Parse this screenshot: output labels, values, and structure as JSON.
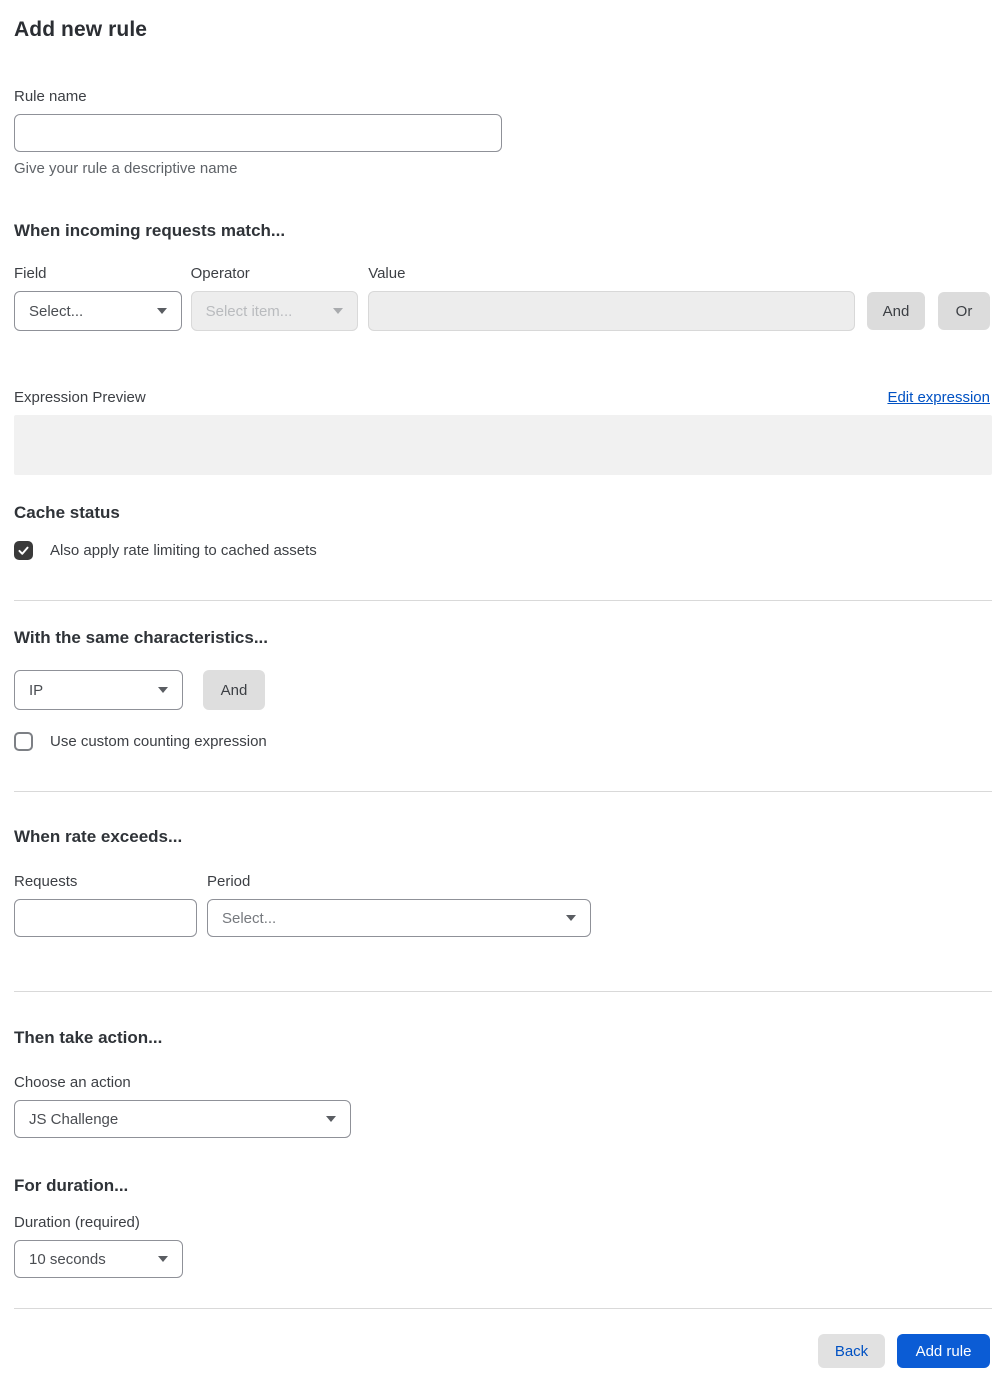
{
  "page": {
    "title": "Add new rule"
  },
  "rule_name": {
    "label": "Rule name",
    "value": "",
    "helper": "Give your rule a descriptive name"
  },
  "match": {
    "heading": "When incoming requests match...",
    "field": {
      "label": "Field",
      "selected": "Select..."
    },
    "operator": {
      "label": "Operator",
      "selected": "Select item...",
      "disabled": true
    },
    "value": {
      "label": "Value",
      "value": "",
      "disabled": true
    },
    "and_button": "And",
    "or_button": "Or"
  },
  "expression": {
    "label": "Expression Preview",
    "edit_link": "Edit expression",
    "preview_value": ""
  },
  "cache": {
    "heading": "Cache status",
    "checkbox_label": "Also apply rate limiting to cached assets",
    "checked": true
  },
  "characteristics": {
    "heading": "With the same characteristics...",
    "selected": "IP",
    "and_button": "And",
    "checkbox_label": "Use custom counting expression",
    "checked": false
  },
  "rate": {
    "heading": "When rate exceeds...",
    "requests": {
      "label": "Requests",
      "value": ""
    },
    "period": {
      "label": "Period",
      "selected": "Select..."
    }
  },
  "action": {
    "heading": "Then take action...",
    "label": "Choose an action",
    "selected": "JS Challenge"
  },
  "duration": {
    "heading": "For duration...",
    "label": "Duration (required)",
    "selected": "10 seconds"
  },
  "footer": {
    "back_button": "Back",
    "add_rule_button": "Add rule"
  },
  "colors": {
    "primary_button_blue": "#0b5cd5",
    "link_blue": "#0051c3",
    "checkbox_checked": "#3a3a3a",
    "disabled_field_bg": "#ededed",
    "expression_box_bg": "#f1f1f1"
  }
}
